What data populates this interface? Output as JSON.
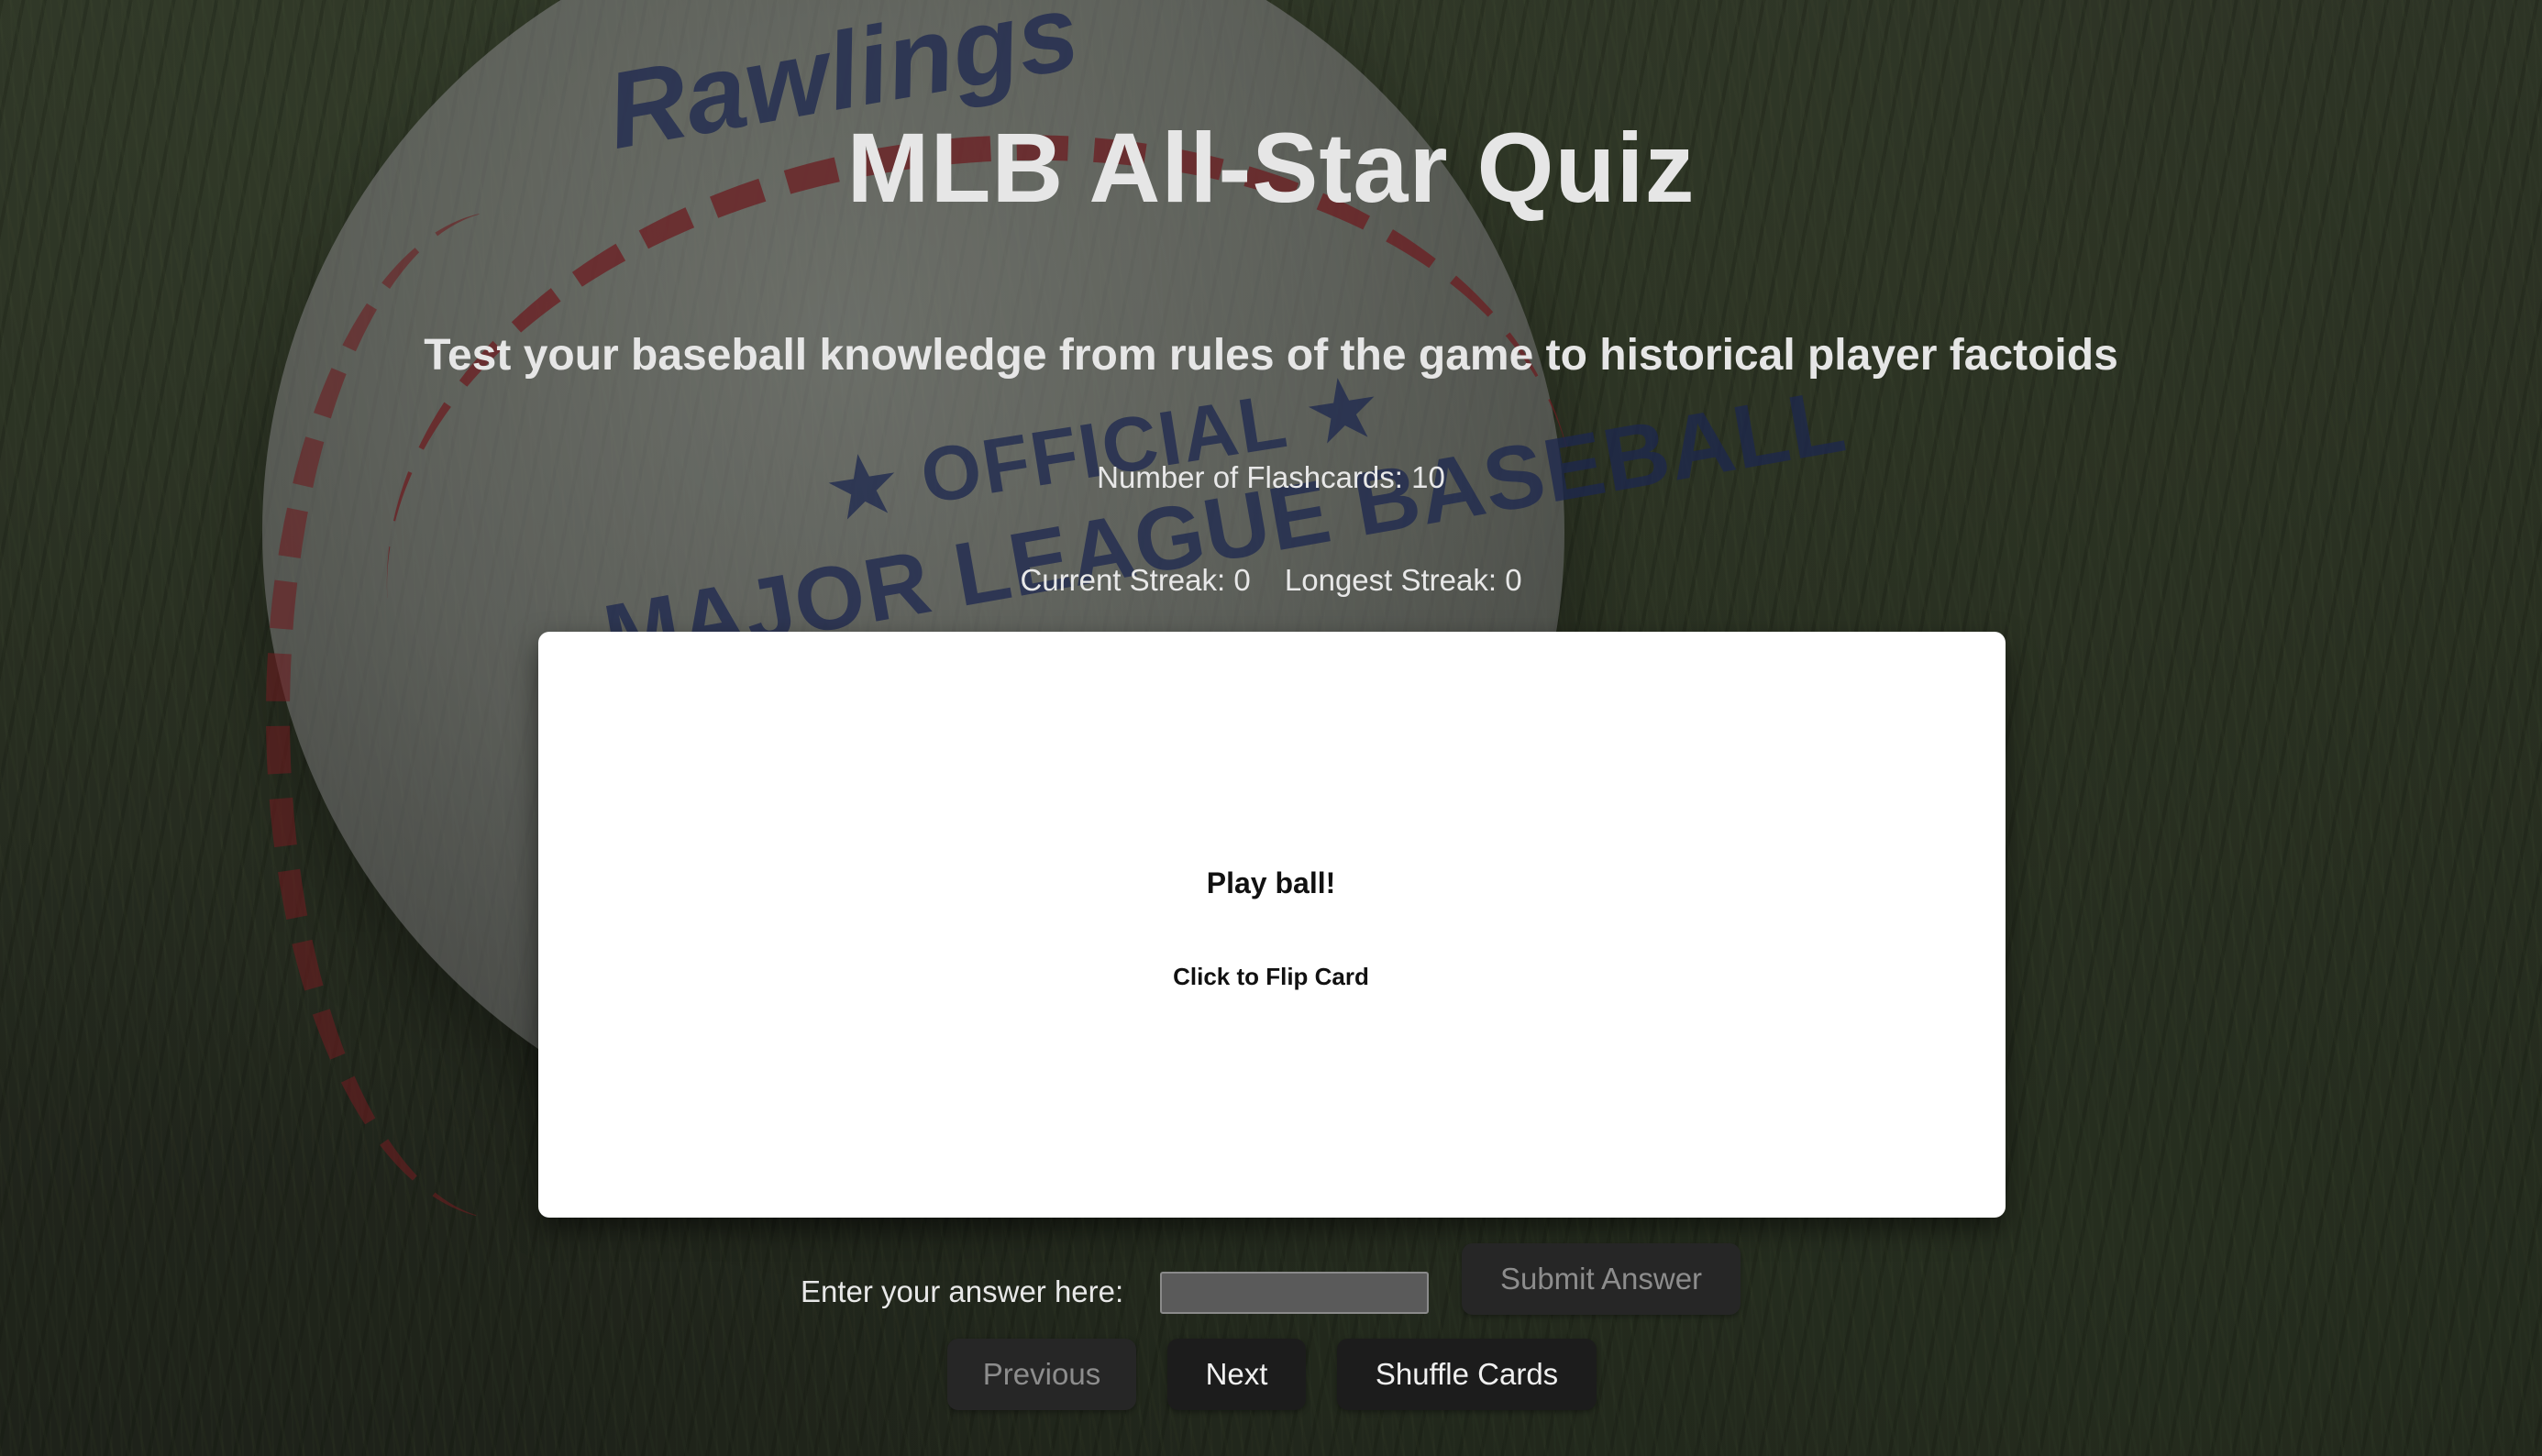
{
  "header": {
    "title": "MLB All-Star Quiz",
    "subtitle": "Test your baseball knowledge from rules of the game to historical player factoids"
  },
  "stats": {
    "flashcard_count_text": "Number of Flashcards: 10",
    "current_streak_text": "Current Streak: 0",
    "longest_streak_text": "Longest Streak: 0"
  },
  "card": {
    "question": "Play ball!",
    "hint": "Click to Flip Card"
  },
  "answer": {
    "label": "Enter your answer here:",
    "value": "",
    "submit_label": "Submit Answer"
  },
  "navigation": {
    "previous_label": "Previous",
    "next_label": "Next",
    "shuffle_label": "Shuffle Cards"
  },
  "background": {
    "image": "baseball on grass",
    "ball_brand": "Rawlings",
    "ball_official": "★ OFFICIAL ★",
    "ball_league": "MAJOR LEAGUE BASEBALL"
  },
  "colors": {
    "card": "#ffffff",
    "button": "#1c1c1c",
    "button_disabled_text": "#8d8d8d",
    "text": "#e6e6e6"
  }
}
